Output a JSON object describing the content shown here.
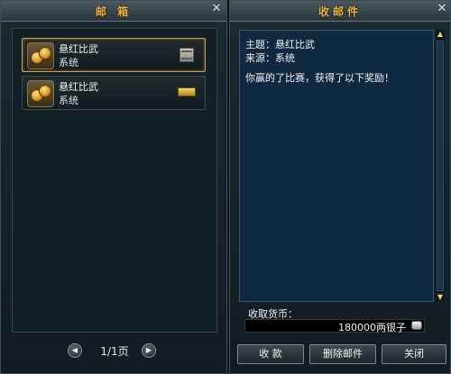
{
  "mailbox": {
    "title": "邮 箱",
    "items": [
      {
        "subject": "悬红比武",
        "sender": "系统",
        "icon": "scroll-icon",
        "selected": true
      },
      {
        "subject": "悬红比武",
        "sender": "系统",
        "icon": "gold-bundle-icon",
        "selected": false
      }
    ],
    "pager": {
      "text": "1/1页",
      "prev": "◀",
      "next": "▶"
    }
  },
  "reader": {
    "title": "收邮件",
    "subject_line": "主题：悬红比武",
    "source_line": "来源：系统",
    "body": "你赢的了比赛，获得了以下奖励！",
    "currency_label": "收取货币：",
    "currency_value": "180000两银子",
    "buttons": {
      "collect": "收 款",
      "delete": "删除邮件",
      "close": "关闭"
    },
    "scroll": {
      "up": "▲",
      "down": "▼"
    }
  },
  "close_glyph": "✕",
  "colors": {
    "title": "#f2b33a",
    "selected_border": "#c9a352",
    "reader_bg": "#0f2940"
  }
}
